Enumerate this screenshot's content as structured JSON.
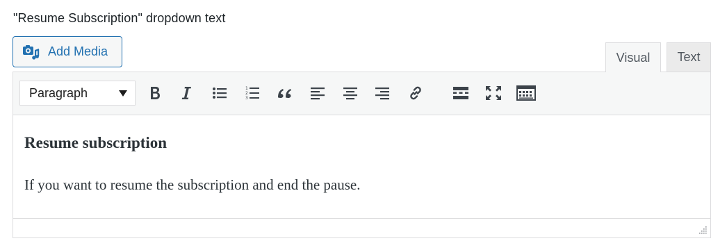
{
  "field": {
    "label": "\"Resume Subscription\" dropdown text"
  },
  "media": {
    "add_media_label": "Add Media",
    "icon": "media-camera-music-icon"
  },
  "tabs": {
    "visual": "Visual",
    "text": "Text",
    "active": "Visual"
  },
  "toolbar": {
    "format_select_value": "Paragraph",
    "buttons": [
      "bold-icon",
      "italic-icon",
      "bulleted-list-icon",
      "numbered-list-icon",
      "blockquote-icon",
      "align-left-icon",
      "align-center-icon",
      "align-right-icon",
      "insert-link-icon",
      "read-more-tag-icon",
      "fullscreen-icon",
      "toolbar-toggle-icon"
    ]
  },
  "content": {
    "heading": "Resume subscription",
    "paragraph": "If you want to resume the subscription and end the pause."
  },
  "colors": {
    "accent": "#2271b1",
    "toolbar_bg": "#f6f7f7",
    "border": "#dcdcde",
    "icon": "#3c434a"
  }
}
